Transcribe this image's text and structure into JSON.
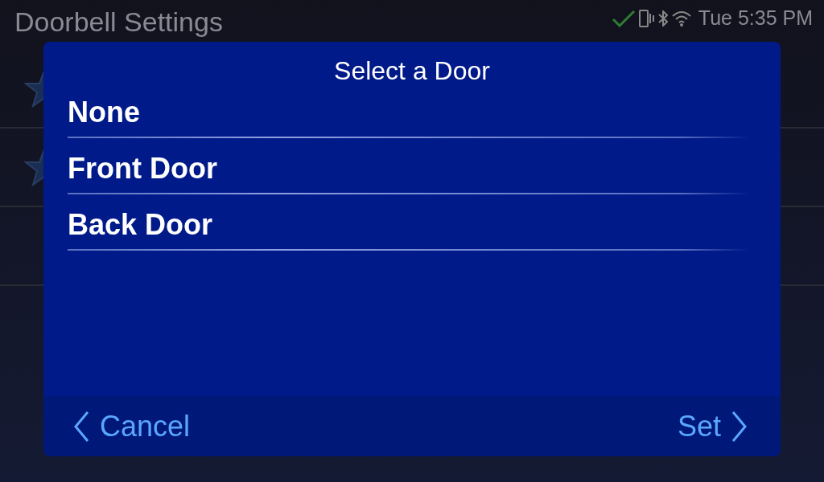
{
  "screen": {
    "title": "Doorbell Settings",
    "status_time": "Tue 5:35 PM"
  },
  "dialog": {
    "title": "Select a Door",
    "options": [
      {
        "label": "None"
      },
      {
        "label": "Front Door"
      },
      {
        "label": "Back Door"
      }
    ],
    "cancel": "Cancel",
    "confirm": "Set"
  }
}
